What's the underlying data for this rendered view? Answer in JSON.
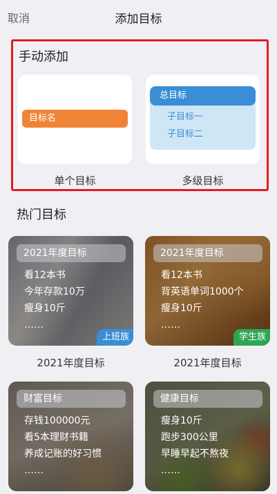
{
  "nav": {
    "cancel": "取消",
    "title": "添加目标"
  },
  "manual": {
    "title": "手动添加",
    "single": {
      "pill": "目标名",
      "label": "单个目标"
    },
    "multi": {
      "head": "总目标",
      "sub1": "子目标一",
      "sub2": "子目标二",
      "label": "多级目标"
    }
  },
  "hot": {
    "title": "热门目标",
    "cards": [
      {
        "head": "2021年度目标",
        "lines": [
          "看12本书",
          "今年存款10万",
          "瘦身10斤",
          "……"
        ],
        "tag": "上班族",
        "caption": "2021年度目标"
      },
      {
        "head": "2021年度目标",
        "lines": [
          "看12本书",
          "背英语单词1000个",
          "瘦身10斤",
          "……"
        ],
        "tag": "学生族",
        "caption": "2021年度目标"
      },
      {
        "head": "财富目标",
        "lines": [
          "存钱100000元",
          "看5本理财书籍",
          "养成记账的好习惯",
          "……"
        ]
      },
      {
        "head": "健康目标",
        "lines": [
          "瘦身10斤",
          "跑步300公里",
          "早睡早起不熬夜",
          "……"
        ]
      }
    ]
  },
  "colors": {
    "highlight_border": "#e11d1d",
    "orange": "#f08436",
    "blue": "#3a8ed5",
    "green": "#2ea653"
  }
}
